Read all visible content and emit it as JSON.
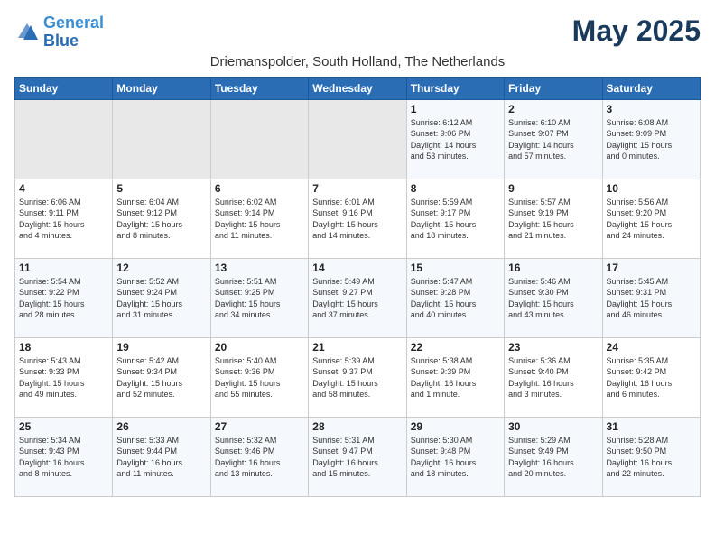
{
  "header": {
    "logo_line1": "General",
    "logo_line2": "Blue",
    "month_title": "May 2025",
    "location": "Driemanspolder, South Holland, The Netherlands"
  },
  "weekdays": [
    "Sunday",
    "Monday",
    "Tuesday",
    "Wednesday",
    "Thursday",
    "Friday",
    "Saturday"
  ],
  "weeks": [
    [
      {
        "day": "",
        "info": ""
      },
      {
        "day": "",
        "info": ""
      },
      {
        "day": "",
        "info": ""
      },
      {
        "day": "",
        "info": ""
      },
      {
        "day": "1",
        "info": "Sunrise: 6:12 AM\nSunset: 9:06 PM\nDaylight: 14 hours\nand 53 minutes."
      },
      {
        "day": "2",
        "info": "Sunrise: 6:10 AM\nSunset: 9:07 PM\nDaylight: 14 hours\nand 57 minutes."
      },
      {
        "day": "3",
        "info": "Sunrise: 6:08 AM\nSunset: 9:09 PM\nDaylight: 15 hours\nand 0 minutes."
      }
    ],
    [
      {
        "day": "4",
        "info": "Sunrise: 6:06 AM\nSunset: 9:11 PM\nDaylight: 15 hours\nand 4 minutes."
      },
      {
        "day": "5",
        "info": "Sunrise: 6:04 AM\nSunset: 9:12 PM\nDaylight: 15 hours\nand 8 minutes."
      },
      {
        "day": "6",
        "info": "Sunrise: 6:02 AM\nSunset: 9:14 PM\nDaylight: 15 hours\nand 11 minutes."
      },
      {
        "day": "7",
        "info": "Sunrise: 6:01 AM\nSunset: 9:16 PM\nDaylight: 15 hours\nand 14 minutes."
      },
      {
        "day": "8",
        "info": "Sunrise: 5:59 AM\nSunset: 9:17 PM\nDaylight: 15 hours\nand 18 minutes."
      },
      {
        "day": "9",
        "info": "Sunrise: 5:57 AM\nSunset: 9:19 PM\nDaylight: 15 hours\nand 21 minutes."
      },
      {
        "day": "10",
        "info": "Sunrise: 5:56 AM\nSunset: 9:20 PM\nDaylight: 15 hours\nand 24 minutes."
      }
    ],
    [
      {
        "day": "11",
        "info": "Sunrise: 5:54 AM\nSunset: 9:22 PM\nDaylight: 15 hours\nand 28 minutes."
      },
      {
        "day": "12",
        "info": "Sunrise: 5:52 AM\nSunset: 9:24 PM\nDaylight: 15 hours\nand 31 minutes."
      },
      {
        "day": "13",
        "info": "Sunrise: 5:51 AM\nSunset: 9:25 PM\nDaylight: 15 hours\nand 34 minutes."
      },
      {
        "day": "14",
        "info": "Sunrise: 5:49 AM\nSunset: 9:27 PM\nDaylight: 15 hours\nand 37 minutes."
      },
      {
        "day": "15",
        "info": "Sunrise: 5:47 AM\nSunset: 9:28 PM\nDaylight: 15 hours\nand 40 minutes."
      },
      {
        "day": "16",
        "info": "Sunrise: 5:46 AM\nSunset: 9:30 PM\nDaylight: 15 hours\nand 43 minutes."
      },
      {
        "day": "17",
        "info": "Sunrise: 5:45 AM\nSunset: 9:31 PM\nDaylight: 15 hours\nand 46 minutes."
      }
    ],
    [
      {
        "day": "18",
        "info": "Sunrise: 5:43 AM\nSunset: 9:33 PM\nDaylight: 15 hours\nand 49 minutes."
      },
      {
        "day": "19",
        "info": "Sunrise: 5:42 AM\nSunset: 9:34 PM\nDaylight: 15 hours\nand 52 minutes."
      },
      {
        "day": "20",
        "info": "Sunrise: 5:40 AM\nSunset: 9:36 PM\nDaylight: 15 hours\nand 55 minutes."
      },
      {
        "day": "21",
        "info": "Sunrise: 5:39 AM\nSunset: 9:37 PM\nDaylight: 15 hours\nand 58 minutes."
      },
      {
        "day": "22",
        "info": "Sunrise: 5:38 AM\nSunset: 9:39 PM\nDaylight: 16 hours\nand 1 minute."
      },
      {
        "day": "23",
        "info": "Sunrise: 5:36 AM\nSunset: 9:40 PM\nDaylight: 16 hours\nand 3 minutes."
      },
      {
        "day": "24",
        "info": "Sunrise: 5:35 AM\nSunset: 9:42 PM\nDaylight: 16 hours\nand 6 minutes."
      }
    ],
    [
      {
        "day": "25",
        "info": "Sunrise: 5:34 AM\nSunset: 9:43 PM\nDaylight: 16 hours\nand 8 minutes."
      },
      {
        "day": "26",
        "info": "Sunrise: 5:33 AM\nSunset: 9:44 PM\nDaylight: 16 hours\nand 11 minutes."
      },
      {
        "day": "27",
        "info": "Sunrise: 5:32 AM\nSunset: 9:46 PM\nDaylight: 16 hours\nand 13 minutes."
      },
      {
        "day": "28",
        "info": "Sunrise: 5:31 AM\nSunset: 9:47 PM\nDaylight: 16 hours\nand 15 minutes."
      },
      {
        "day": "29",
        "info": "Sunrise: 5:30 AM\nSunset: 9:48 PM\nDaylight: 16 hours\nand 18 minutes."
      },
      {
        "day": "30",
        "info": "Sunrise: 5:29 AM\nSunset: 9:49 PM\nDaylight: 16 hours\nand 20 minutes."
      },
      {
        "day": "31",
        "info": "Sunrise: 5:28 AM\nSunset: 9:50 PM\nDaylight: 16 hours\nand 22 minutes."
      }
    ]
  ]
}
